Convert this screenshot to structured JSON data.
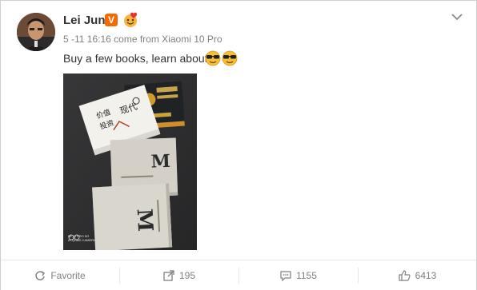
{
  "post": {
    "username": "Lei Jun",
    "verified_badge": "V",
    "timestamp": "5 -11 16:16",
    "source": "come from Xiaomi 10 Pro",
    "text": "Buy a few books, learn about",
    "icons": {
      "verified": "verified-v-icon",
      "badge": "fan-heart-badge-icon",
      "emoji": "sunglasses-emoji-icon",
      "menu": "chevron-down-icon"
    }
  },
  "photo": {
    "watermark": "MI 10 PRO 5G\nAI QUAD CAMERA"
  },
  "actions": {
    "favorite_label": "Favorite",
    "repost_count": "195",
    "comment_count": "1155",
    "like_count": "6413"
  },
  "colors": {
    "badge_orange": "#f56a00",
    "text_dark": "#333333",
    "text_gray": "#808080",
    "border": "#cfcfcf"
  }
}
